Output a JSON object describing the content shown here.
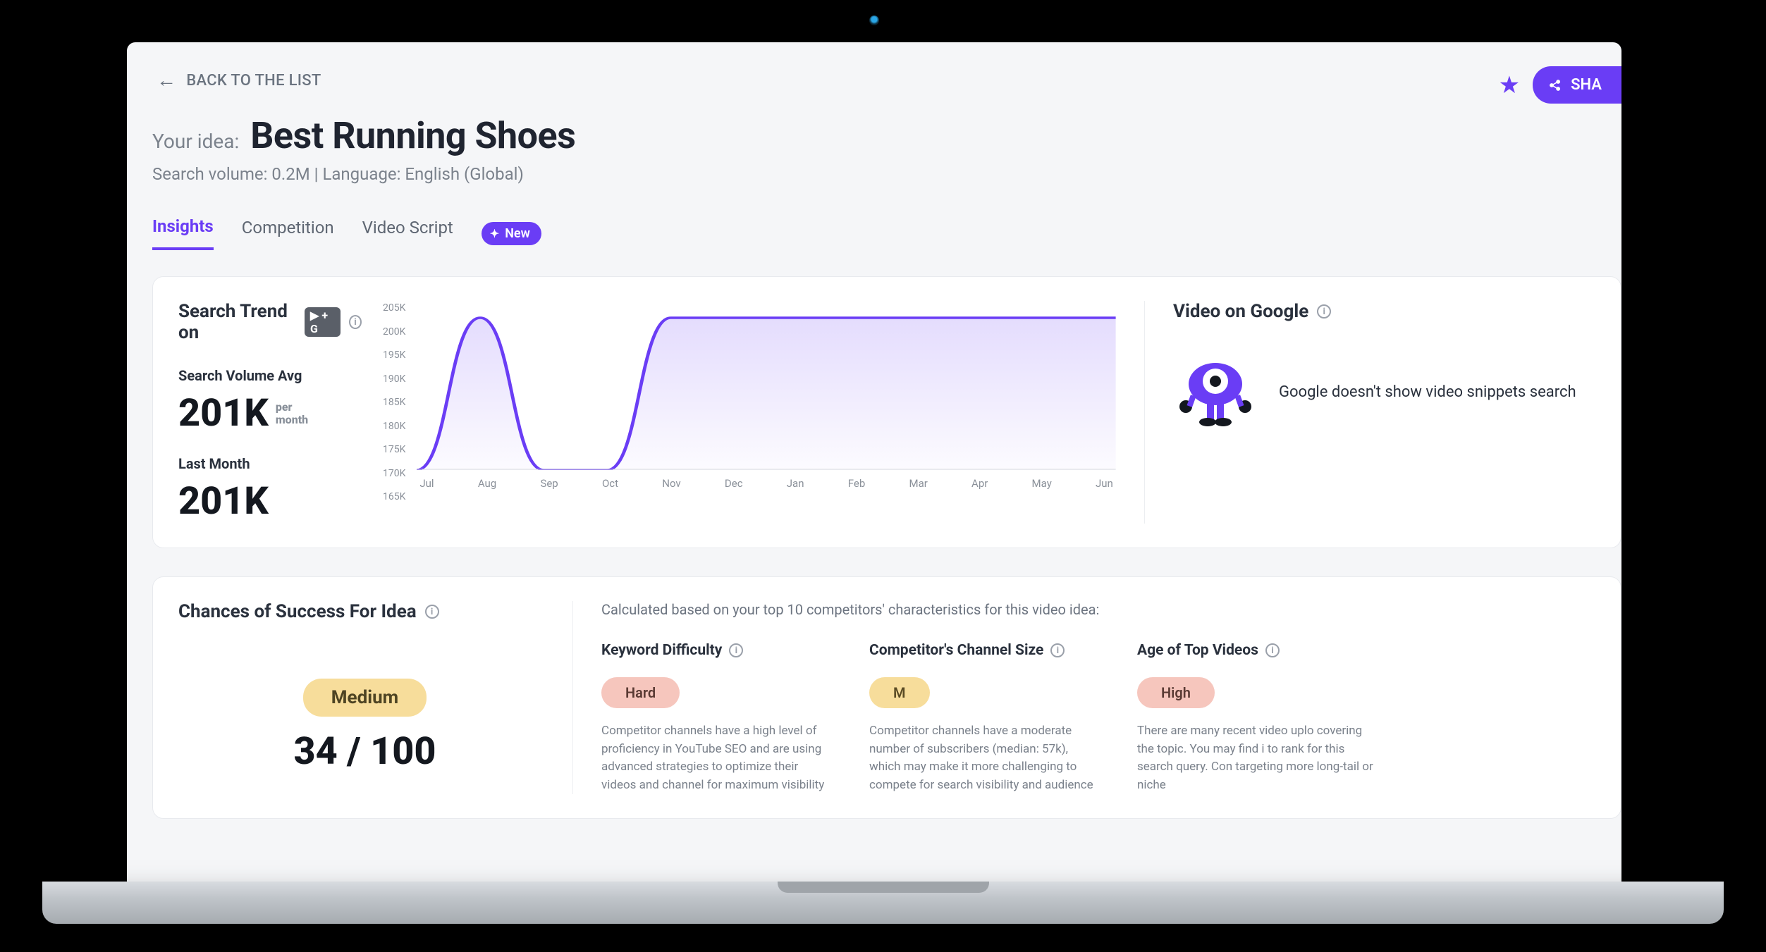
{
  "nav": {
    "back_label": "BACK TO THE LIST",
    "share_label": "SHA"
  },
  "idea": {
    "label": "Your idea:",
    "title": "Best Running Shoes",
    "meta": "Search volume: 0.2M | Language: English (Global)"
  },
  "tabs": {
    "insights": "Insights",
    "competition": "Competition",
    "video_script": "Video Script",
    "new_badge": "New"
  },
  "trend": {
    "title": "Search Trend on",
    "badge": "▶ + G",
    "avg_label": "Search Volume Avg",
    "avg_value": "201K",
    "avg_unit_1": "per",
    "avg_unit_2": "month",
    "last_label": "Last Month",
    "last_value": "201K"
  },
  "chart_data": {
    "type": "line",
    "title": "Search Trend",
    "xlabel": "",
    "ylabel": "",
    "ylim": [
      165000,
      205000
    ],
    "y_ticks": [
      "205K",
      "200K",
      "195K",
      "190K",
      "185K",
      "180K",
      "175K",
      "170K",
      "165K"
    ],
    "categories": [
      "Jul",
      "Aug",
      "Sep",
      "Oct",
      "Nov",
      "Dec",
      "Jan",
      "Feb",
      "Mar",
      "Apr",
      "May",
      "Jun"
    ],
    "values": [
      165000,
      201000,
      165000,
      165000,
      201000,
      201000,
      201000,
      201000,
      201000,
      201000,
      201000,
      201000
    ]
  },
  "vog": {
    "title": "Video on Google",
    "text": "Google doesn't show video snippets search"
  },
  "success": {
    "title": "Chances of Success For Idea",
    "chance_label": "Medium",
    "chance_score": "34 / 100",
    "calc_text": "Calculated based on your top 10 competitors' characteristics for this video idea:",
    "kd": {
      "title": "Keyword Difficulty",
      "pill": "Hard",
      "desc": "Competitor channels have a high level of proficiency in YouTube SEO and are using advanced strategies to optimize their videos and channel for maximum visibility"
    },
    "cs": {
      "title": "Competitor's Channel Size",
      "pill": "M",
      "desc": "Competitor channels have a moderate number of subscribers (median: 57k), which may make it more challenging to compete for search visibility and audience"
    },
    "age": {
      "title": "Age of Top Videos",
      "pill": "High",
      "desc": "There are many recent video uplo covering the topic. You may find i to rank for this search query. Con targeting more long-tail or niche"
    }
  }
}
